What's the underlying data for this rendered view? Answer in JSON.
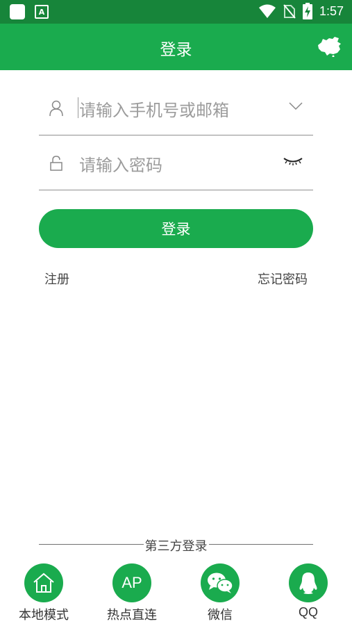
{
  "status_bar": {
    "time": "1:57"
  },
  "header": {
    "title": "登录"
  },
  "form": {
    "account_placeholder": "请输入手机号或邮箱",
    "password_placeholder": "请输入密码",
    "login_button": "登录",
    "register_link": "注册",
    "forgot_link": "忘记密码"
  },
  "third_party": {
    "title": "第三方登录",
    "items": [
      {
        "label": "本地模式",
        "icon": "home-icon"
      },
      {
        "label": "热点直连",
        "icon": "ap-icon",
        "icon_text": "AP"
      },
      {
        "label": "微信",
        "icon": "wechat-icon"
      },
      {
        "label": "QQ",
        "icon": "qq-icon"
      }
    ]
  },
  "colors": {
    "primary": "#1aab4e",
    "status_bar": "#17853a"
  }
}
